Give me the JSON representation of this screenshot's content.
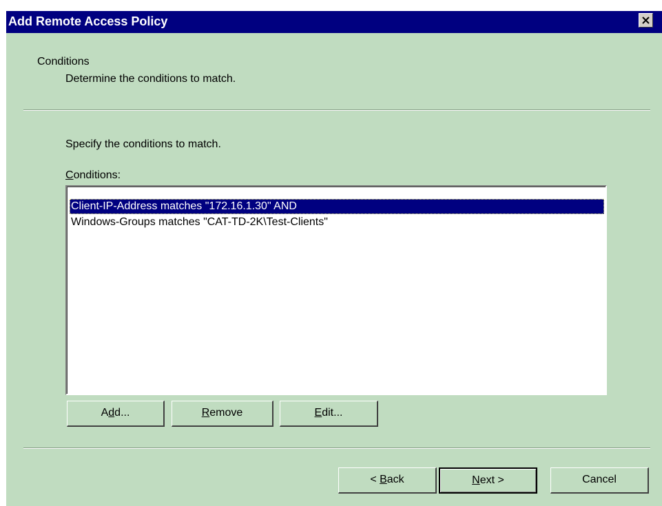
{
  "window": {
    "title": "Add Remote Access Policy",
    "close_icon": "close-icon"
  },
  "header": {
    "title": "Conditions",
    "subtitle": "Determine the conditions to match."
  },
  "body": {
    "instructions": "Specify the conditions to match.",
    "conditions_label": {
      "mnemonic": "C",
      "rest": "onditions:"
    },
    "conditions": [
      {
        "text": "Client-IP-Address matches \"172.16.1.30\"  AND",
        "selected": true
      },
      {
        "text": "Windows-Groups matches \"CAT-TD-2K\\Test-Clients\"",
        "selected": false
      }
    ]
  },
  "condition_buttons": {
    "add": {
      "pre": "A",
      "mnemonic": "d",
      "post": "d..."
    },
    "remove": {
      "pre": "",
      "mnemonic": "R",
      "post": "emove"
    },
    "edit": {
      "pre": "",
      "mnemonic": "E",
      "post": "dit..."
    }
  },
  "nav_buttons": {
    "back": {
      "pre": "< ",
      "mnemonic": "B",
      "post": "ack"
    },
    "next": {
      "pre": "",
      "mnemonic": "N",
      "post": "ext >"
    },
    "cancel": {
      "label": "Cancel"
    }
  },
  "colors": {
    "dialog_background": "#c0dcc0",
    "titlebar": "#000080",
    "selection": "#000080"
  }
}
